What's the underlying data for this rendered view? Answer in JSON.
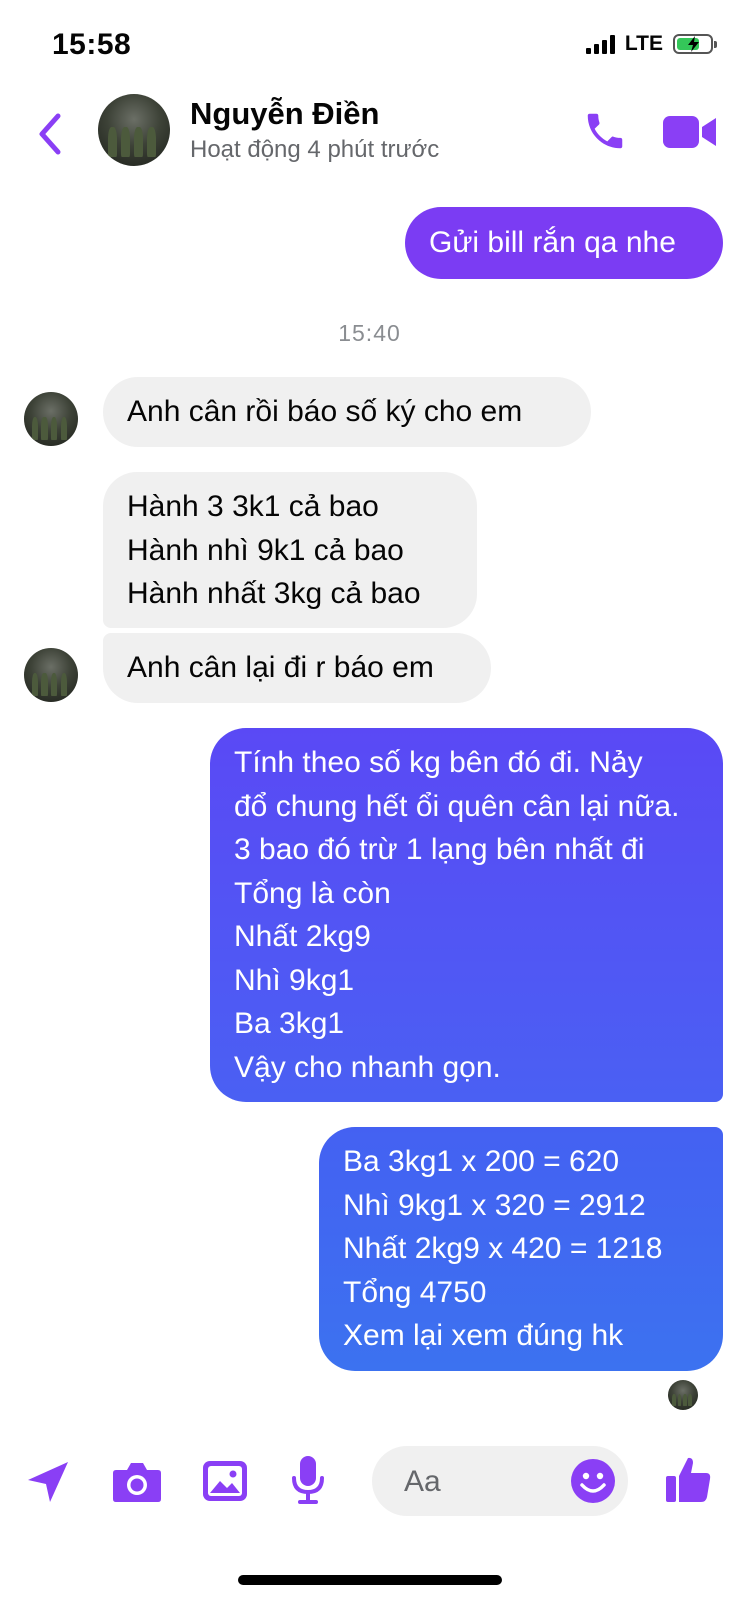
{
  "status_bar": {
    "time": "15:58",
    "network": "LTE"
  },
  "header": {
    "contact_name": "Nguyễn Điền",
    "contact_status": "Hoạt động 4 phút trước"
  },
  "messages": {
    "m0": {
      "lines": [
        "Gửi bill rắn qa nhe"
      ]
    },
    "timestamp": "15:40",
    "m1": {
      "lines": [
        "Anh cân rồi báo số ký cho em"
      ]
    },
    "m2": {
      "lines": [
        "Hành 3 3k1 cả bao",
        "Hành nhì 9k1 cả bao",
        "Hành nhất 3kg cả bao"
      ]
    },
    "m3": {
      "lines": [
        "Anh cân lại đi r báo em"
      ]
    },
    "m4": {
      "lines": [
        "Tính theo số kg bên đó đi. Nảy",
        "đổ chung hết ổi quên cân lại nữa.",
        "3 bao đó trừ 1 lạng bên nhất đi",
        "Tổng là còn",
        "Nhất 2kg9",
        "Nhì 9kg1",
        "Ba 3kg1",
        "Vậy cho nhanh gọn."
      ]
    },
    "m5": {
      "lines": [
        "Ba 3kg1 x 200 = 620",
        "Nhì 9kg1 x 320 = 2912",
        "Nhất 2kg9 x 420 = 1218",
        "Tổng 4750",
        "Xem lại xem đúng hk"
      ]
    }
  },
  "composer": {
    "placeholder": "Aa"
  },
  "colors": {
    "accent": "#8a3ff5",
    "sent_purple": "#7b3cf3",
    "sent_blue": "#4a60f3",
    "received_bg": "#f0f0f0",
    "muted_text": "#65676b"
  },
  "icons": {
    "back": "chevron-left-icon",
    "call": "phone-icon",
    "video": "video-camera-icon",
    "send_location": "location-arrow-icon",
    "camera": "camera-icon",
    "gallery": "image-icon",
    "voice": "microphone-icon",
    "emoji": "smiley-icon",
    "like": "thumbs-up-icon"
  }
}
